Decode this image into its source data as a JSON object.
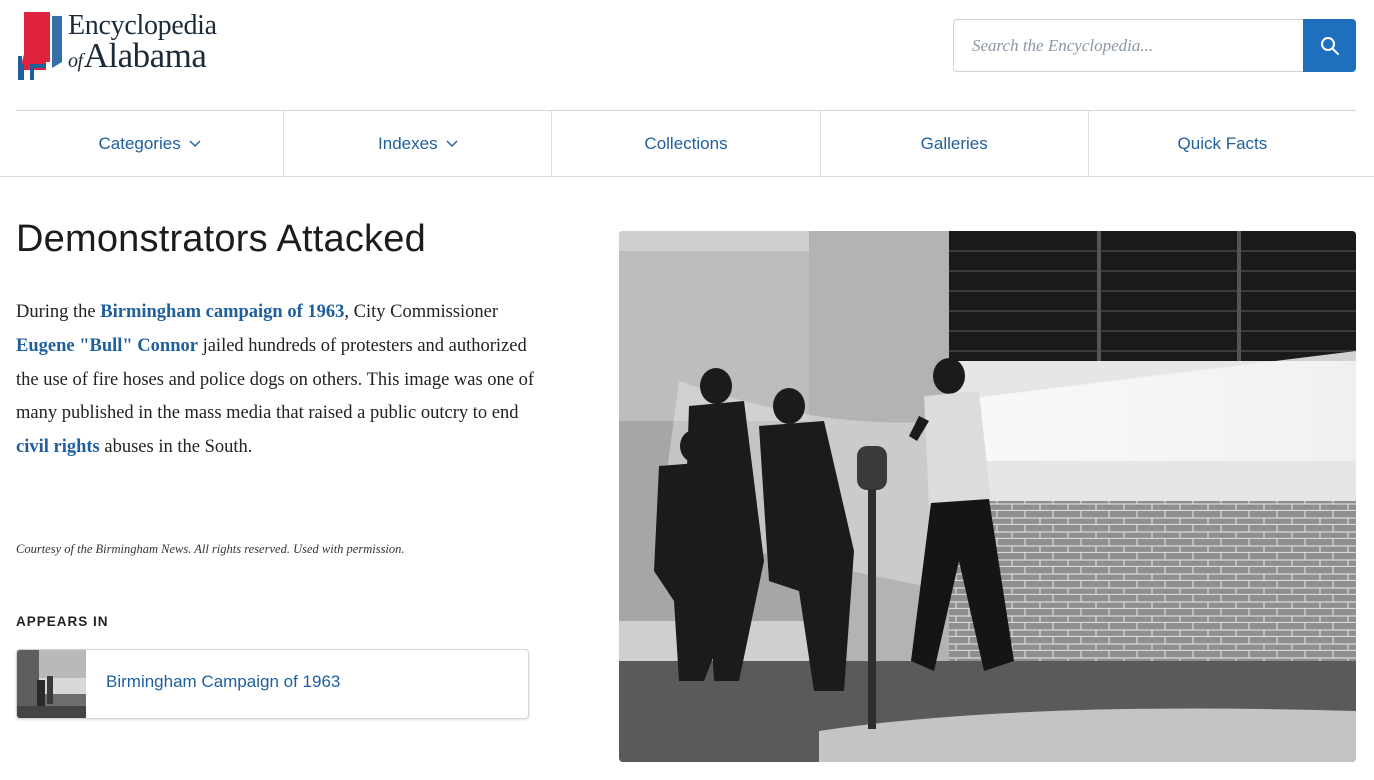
{
  "site": {
    "logo_line1": "Encyclopedia",
    "logo_of": "of",
    "logo_line2": "Alabama",
    "accent_blue": "#1f6fbf",
    "link_blue": "#1f5f9e",
    "logo_red": "#e0233d"
  },
  "search": {
    "placeholder": "Search the Encyclopedia...",
    "button_icon": "search-icon"
  },
  "nav": {
    "items": [
      {
        "label": "Categories",
        "icon": "chevron-down-icon"
      },
      {
        "label": "Indexes",
        "icon": "chevron-down-icon"
      },
      {
        "label": "Collections"
      },
      {
        "label": "Galleries"
      },
      {
        "label": "Quick Facts"
      }
    ]
  },
  "article": {
    "title": "Demonstrators Attacked",
    "desc": {
      "t1": "During the ",
      "link1": "Birmingham campaign of 1963",
      "t2": ", City Commissioner ",
      "link2": "Eugene \"Bull\" Connor",
      "t3": " jailed hundreds of protesters and authorized the use of fire hoses and police dogs on others. This image was one of many published in the mass media that raised a public outcry to end ",
      "link3": "civil rights",
      "t4": " abuses in the South."
    },
    "credit": "Courtesy of the Birmingham News. All rights reserved. Used with permission."
  },
  "appears_in": {
    "label": "APPEARS IN",
    "items": [
      {
        "title": "Birmingham Campaign of 1963"
      }
    ]
  }
}
